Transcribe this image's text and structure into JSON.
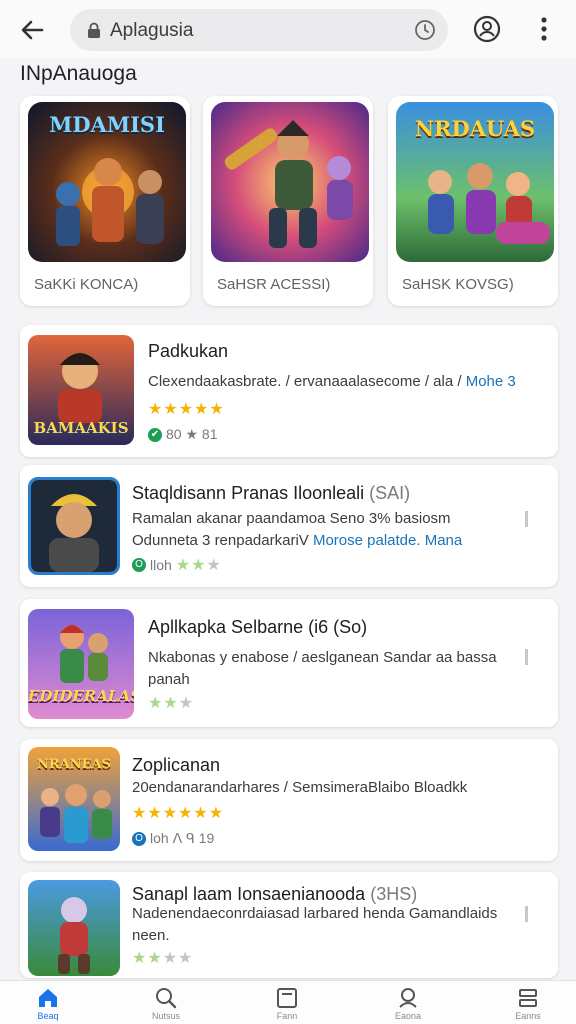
{
  "header": {
    "url": "Aplagusia",
    "icons": [
      "back-arrow-icon",
      "lock-icon",
      "clock-icon",
      "account-icon",
      "more-vert-icon"
    ]
  },
  "section": {
    "title": "INpAnauoga"
  },
  "featured": [
    {
      "art_title": "MDAMISI",
      "label": "SaKKi KONCA)"
    },
    {
      "art_title": "",
      "label": "SaHSR ACESSI)"
    },
    {
      "art_title": "NRDAUAS",
      "label": "SaHSK KOVSG)"
    }
  ],
  "apps": [
    {
      "title": "Padkukan",
      "title_extra": "",
      "desc_main": "Clexendaakasbrate. / ervanaaalasecome / ala /",
      "desc_link": "Mohe 3",
      "desc_rest": "",
      "icon_label": "BAMAAKIS",
      "rating_meta": "80 ★ 81",
      "badge": "✔"
    },
    {
      "title": "Staqldisann Pranas Iloonleali",
      "title_extra": "(SAI)",
      "desc_main": "Ramalan akanar paandamoa Seno 3% basiosm Odunneta 3 renpadarkariV",
      "desc_link": "Morose palatde. Mana",
      "desc_rest": "",
      "icon_label": "",
      "rating_meta": "lloh",
      "badge": "O"
    },
    {
      "title": "Apllkapka Selbarne (i6 (So)",
      "title_extra": "",
      "desc_main": "Nkabonas y enabose / aeslganean Sandar aa bassa panah",
      "desc_link": "",
      "desc_rest": "",
      "icon_label": "EDIDERALAS",
      "rating_meta": "",
      "badge": ""
    },
    {
      "title": "Zoplicanan",
      "title_extra": "",
      "desc_main": "20endanarandarhares / SemsimeraBlaibo Bloadkk",
      "desc_link": "",
      "desc_rest": "",
      "icon_label": "NRANEAS",
      "rating_meta": "loh ᐱ ᑫ 19",
      "badge": "O"
    },
    {
      "title": "Sanapl laam Ionsaenianooda",
      "title_extra": "(3HS)",
      "desc_main": "Nadenendaeconrdaiasad larbared henda Gamandlaids neen.",
      "desc_link": "",
      "desc_rest": "",
      "icon_label": "",
      "rating_meta": "",
      "badge": ""
    }
  ],
  "ratings": [
    {
      "gold": 5,
      "green": 0,
      "gray": 0
    },
    {
      "gold": 0,
      "green": 2,
      "gray": 1
    },
    {
      "gold": 0,
      "green": 2,
      "gray": 1
    },
    {
      "gold": 6,
      "green": 0,
      "gray": 0
    },
    {
      "gold": 0,
      "green": 2,
      "gray": 2
    }
  ],
  "bottom_nav": [
    {
      "label": "Beaq",
      "icon": "home-icon",
      "active": true
    },
    {
      "label": "Nutsus",
      "icon": "search-icon",
      "active": false
    },
    {
      "label": "Fann",
      "icon": "library-icon",
      "active": false
    },
    {
      "label": "Eaona",
      "icon": "profile-icon",
      "active": false
    },
    {
      "label": "Eanns",
      "icon": "apps-icon",
      "active": false
    }
  ],
  "colors": {
    "accent": "#1a73e8",
    "link": "#1a73b8",
    "star": "#f4b400",
    "star_green": "#a6d98a"
  }
}
